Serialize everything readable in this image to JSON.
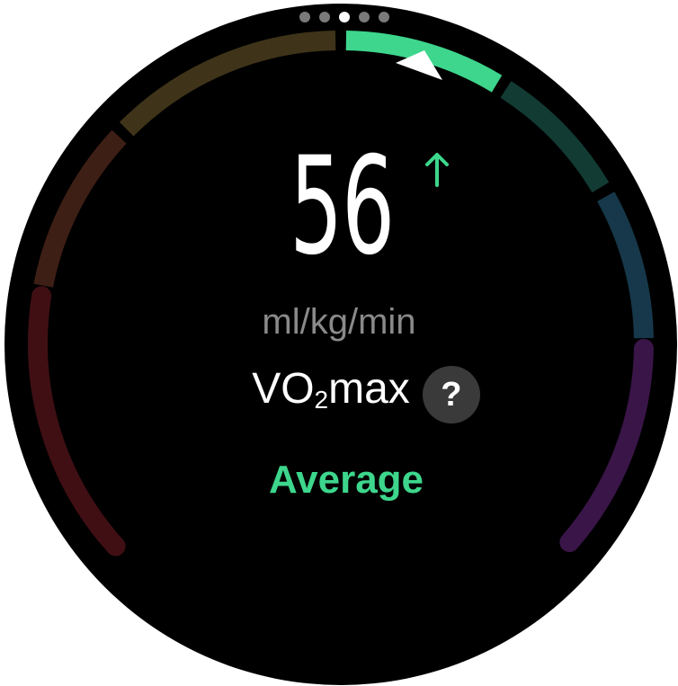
{
  "metric": {
    "value": "56",
    "trend": "up",
    "trend_icon": "arrow-up-icon",
    "unit": "ml/kg/min",
    "name_prefix": "VO",
    "name_subscript": "2",
    "name_suffix": "max",
    "help_label": "?",
    "help_icon": "question-mark-icon",
    "rating": "Average"
  },
  "pager": {
    "total": 5,
    "active_index": 2
  },
  "colors": {
    "background": "#000000",
    "value_text": "#ffffff",
    "unit_text": "#8a8a8a",
    "rating_text": "#3dd68c",
    "trend_arrow": "#3dd68c",
    "help_bg": "#3a3a3a",
    "marker": "#ffffff"
  },
  "gauge": {
    "segments": [
      {
        "zone": "very-poor",
        "color": "#3f0f14",
        "active": false
      },
      {
        "zone": "poor",
        "color": "#3e1f15",
        "active": false
      },
      {
        "zone": "fair",
        "color": "#3f3419",
        "active": false
      },
      {
        "zone": "average",
        "color": "#3dd68c",
        "active": true
      },
      {
        "zone": "good",
        "color": "#123b33",
        "active": false
      },
      {
        "zone": "very-good",
        "color": "#16384a",
        "active": false
      },
      {
        "zone": "excellent",
        "color": "#3a1548",
        "active": false
      }
    ],
    "marker_zone": "average"
  }
}
